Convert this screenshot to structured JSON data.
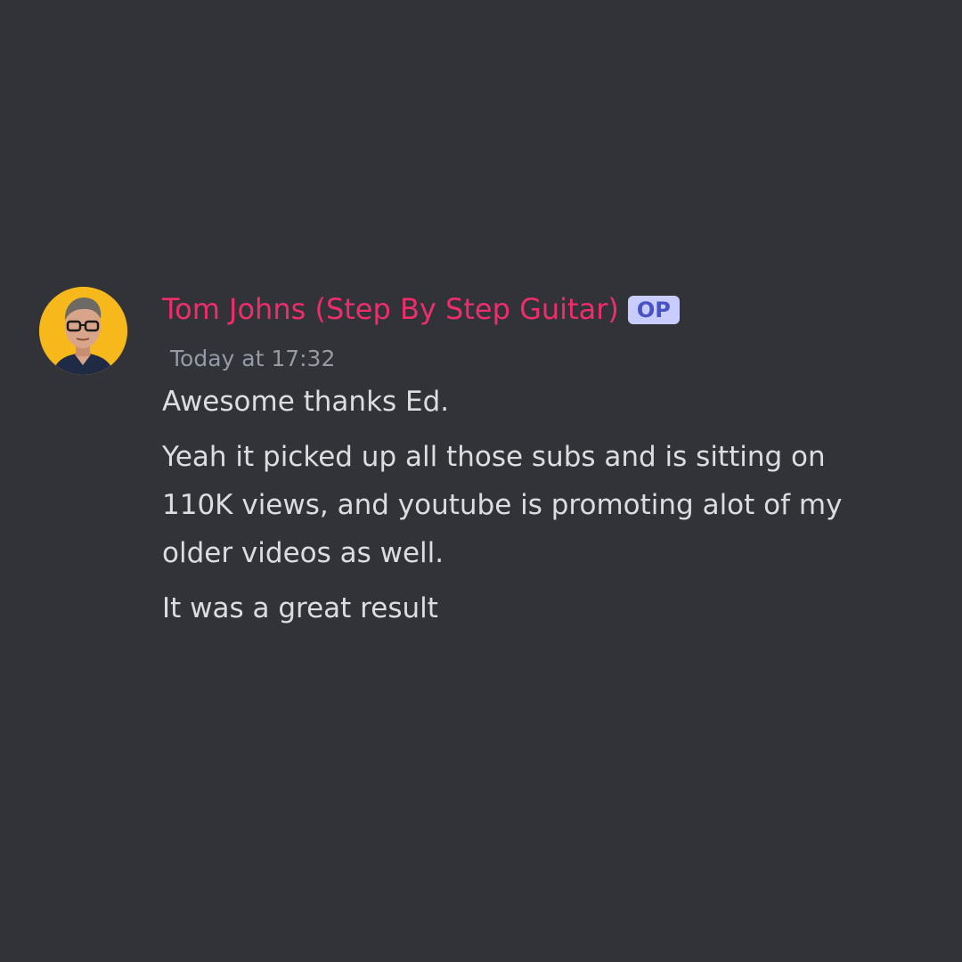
{
  "message": {
    "author": "Tom Johns (Step By Step Guitar)",
    "badge": "OP",
    "timestamp": "Today at 17:32",
    "paragraphs": [
      "Awesome thanks Ed.",
      "Yeah it picked up all those subs and is sitting on 110K views, and youtube is promoting alot of my older videos as well.",
      "It was a great result"
    ],
    "avatar_icon": "user-avatar",
    "colors": {
      "background": "#313338",
      "author": "#ef2d6b",
      "badge_bg": "#c9cdfb",
      "badge_text": "#4752c4",
      "timestamp": "#949ba4",
      "text": "#dbdee1",
      "avatar_bg": "#f6b81b"
    }
  }
}
